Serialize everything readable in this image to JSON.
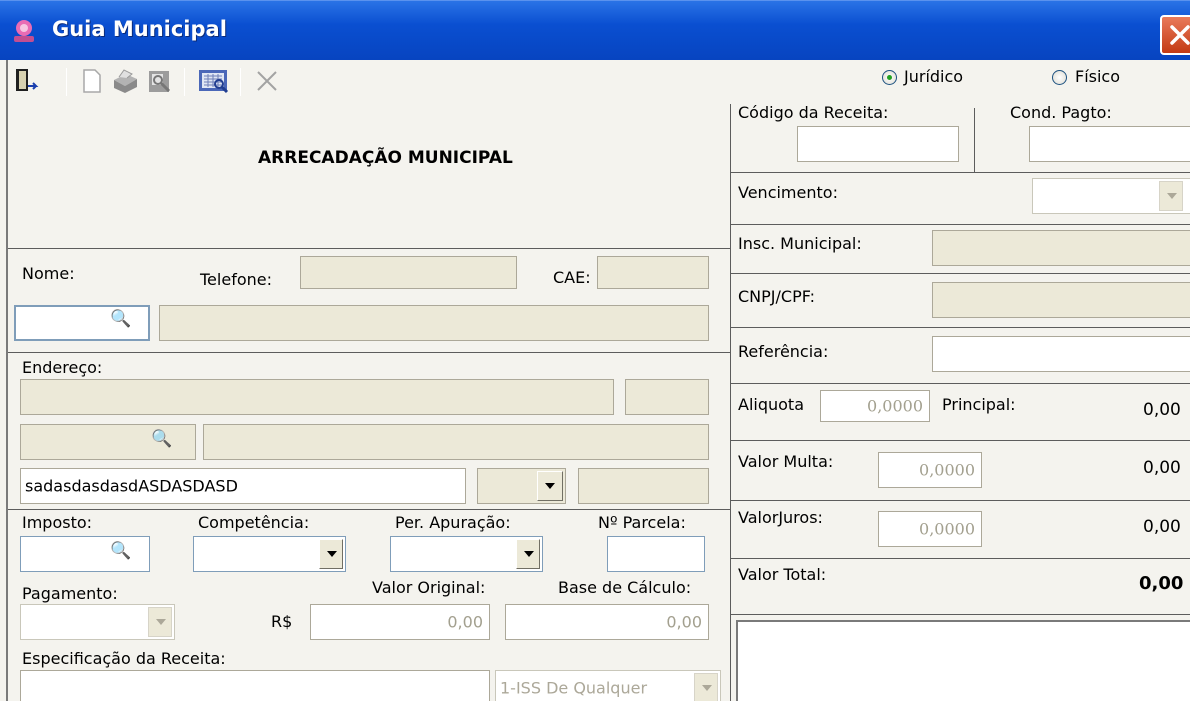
{
  "window": {
    "title": "Guia Municipal"
  },
  "toolbar": {
    "items": [
      "exit-icon",
      "new-icon",
      "print-icon",
      "preview-icon",
      "report-icon",
      "delete-icon"
    ]
  },
  "header": {
    "title": "ARRECADAÇÃO MUNICIPAL"
  },
  "person_type": {
    "options": [
      "Jurídico",
      "Físico"
    ],
    "selected": "Jurídico"
  },
  "contribuinte": {
    "nome_label": "Nome:",
    "telefone_label": "Telefone:",
    "cae_label": "CAE:"
  },
  "endereco": {
    "label": "Endereço:",
    "line3_value": "sadasdasdasdASDASDASD"
  },
  "imposto": {
    "imposto_label": "Imposto:",
    "competencia_label": "Competência:",
    "apuracao_label": "Per. Apuração:",
    "parcela_label": "Nº Parcela:",
    "pagamento_label": "Pagamento:",
    "valor_original_label": "Valor Original:",
    "base_calculo_label": "Base de Cálculo:",
    "currency": "R$",
    "valor_original": "0,00",
    "base_calculo": "0,00",
    "especificacao_label": "Especificação da Receita:",
    "especificacao_select": "1-ISS De Qualquer"
  },
  "receita": {
    "codigo_label": "Código da Receita:",
    "cond_label": "Cond. Pagto:",
    "vencimento_label": "Vencimento:",
    "insc_label": "Insc. Municipal:",
    "cnpj_label": "CNPJ/CPF:",
    "referencia_label": "Referência:",
    "aliquota_label": "Aliquota",
    "aliquota_value": "0,0000",
    "principal_label": "Principal:",
    "principal_value": "0,00",
    "multa_label": "Valor Multa:",
    "multa_value": "0,0000",
    "multa_total": "0,00",
    "juros_label": "ValorJuros:",
    "juros_value": "0,0000",
    "juros_total": "0,00",
    "total_label": "Valor Total:",
    "total_value": "0,00"
  }
}
